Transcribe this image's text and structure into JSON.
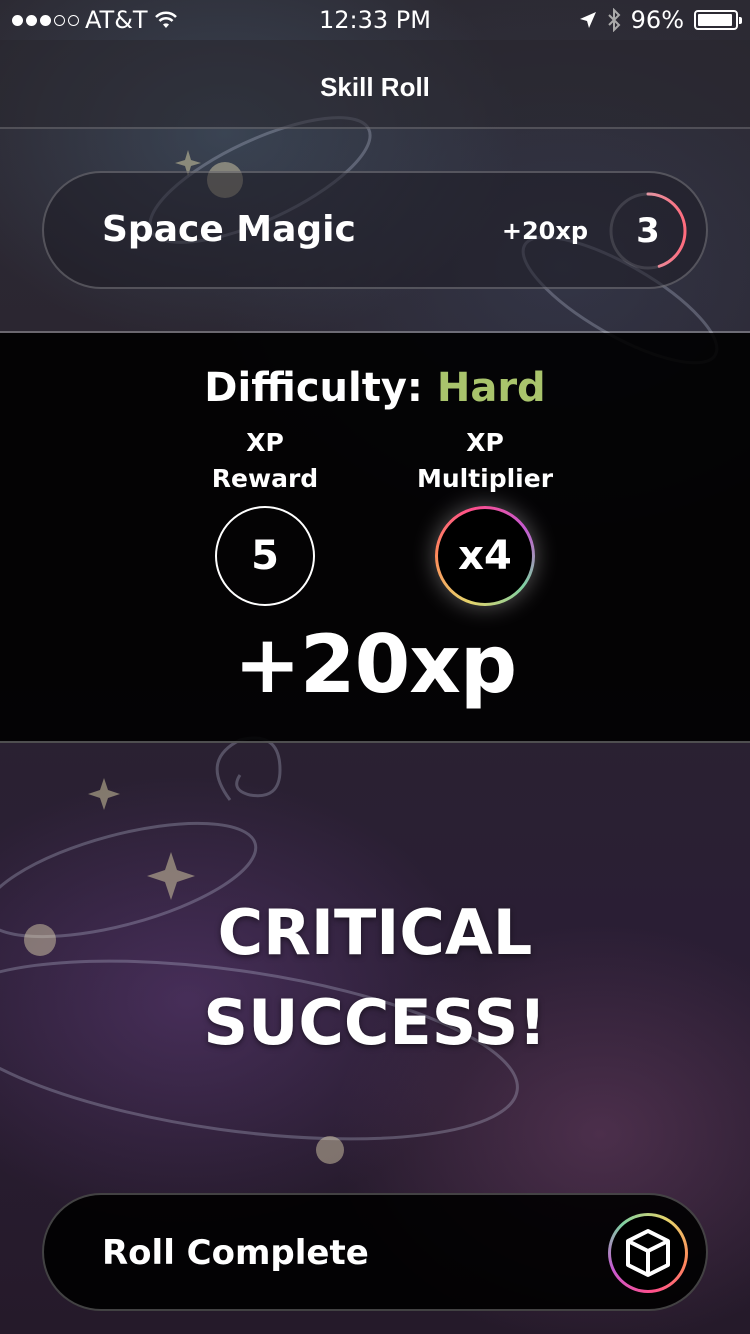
{
  "status_bar": {
    "carrier": "AT&T",
    "time": "12:33 PM",
    "battery_percent": "96%",
    "signal_bars": 3,
    "signal_total": 5,
    "icons": [
      "wifi-icon",
      "location-arrow-icon",
      "bluetooth-icon",
      "battery-icon"
    ]
  },
  "nav": {
    "title": "Skill Roll"
  },
  "skill": {
    "name": "Space Magic",
    "xp_gain": "+20xp",
    "level": "3",
    "level_progress": 0.45
  },
  "difficulty": {
    "label": "Difficulty:",
    "value": "Hard",
    "value_color": "#a9c46c",
    "reward_label_line1": "XP",
    "reward_label_line2": "Reward",
    "reward_value": "5",
    "multiplier_label_line1": "XP",
    "multiplier_label_line2": "Multiplier",
    "multiplier_value": "x4",
    "total": "+20xp"
  },
  "result": {
    "line1": "CRITICAL",
    "line2": "SUCCESS!"
  },
  "roll_button": {
    "label": "Roll Complete",
    "icon": "dice-cube-icon"
  }
}
